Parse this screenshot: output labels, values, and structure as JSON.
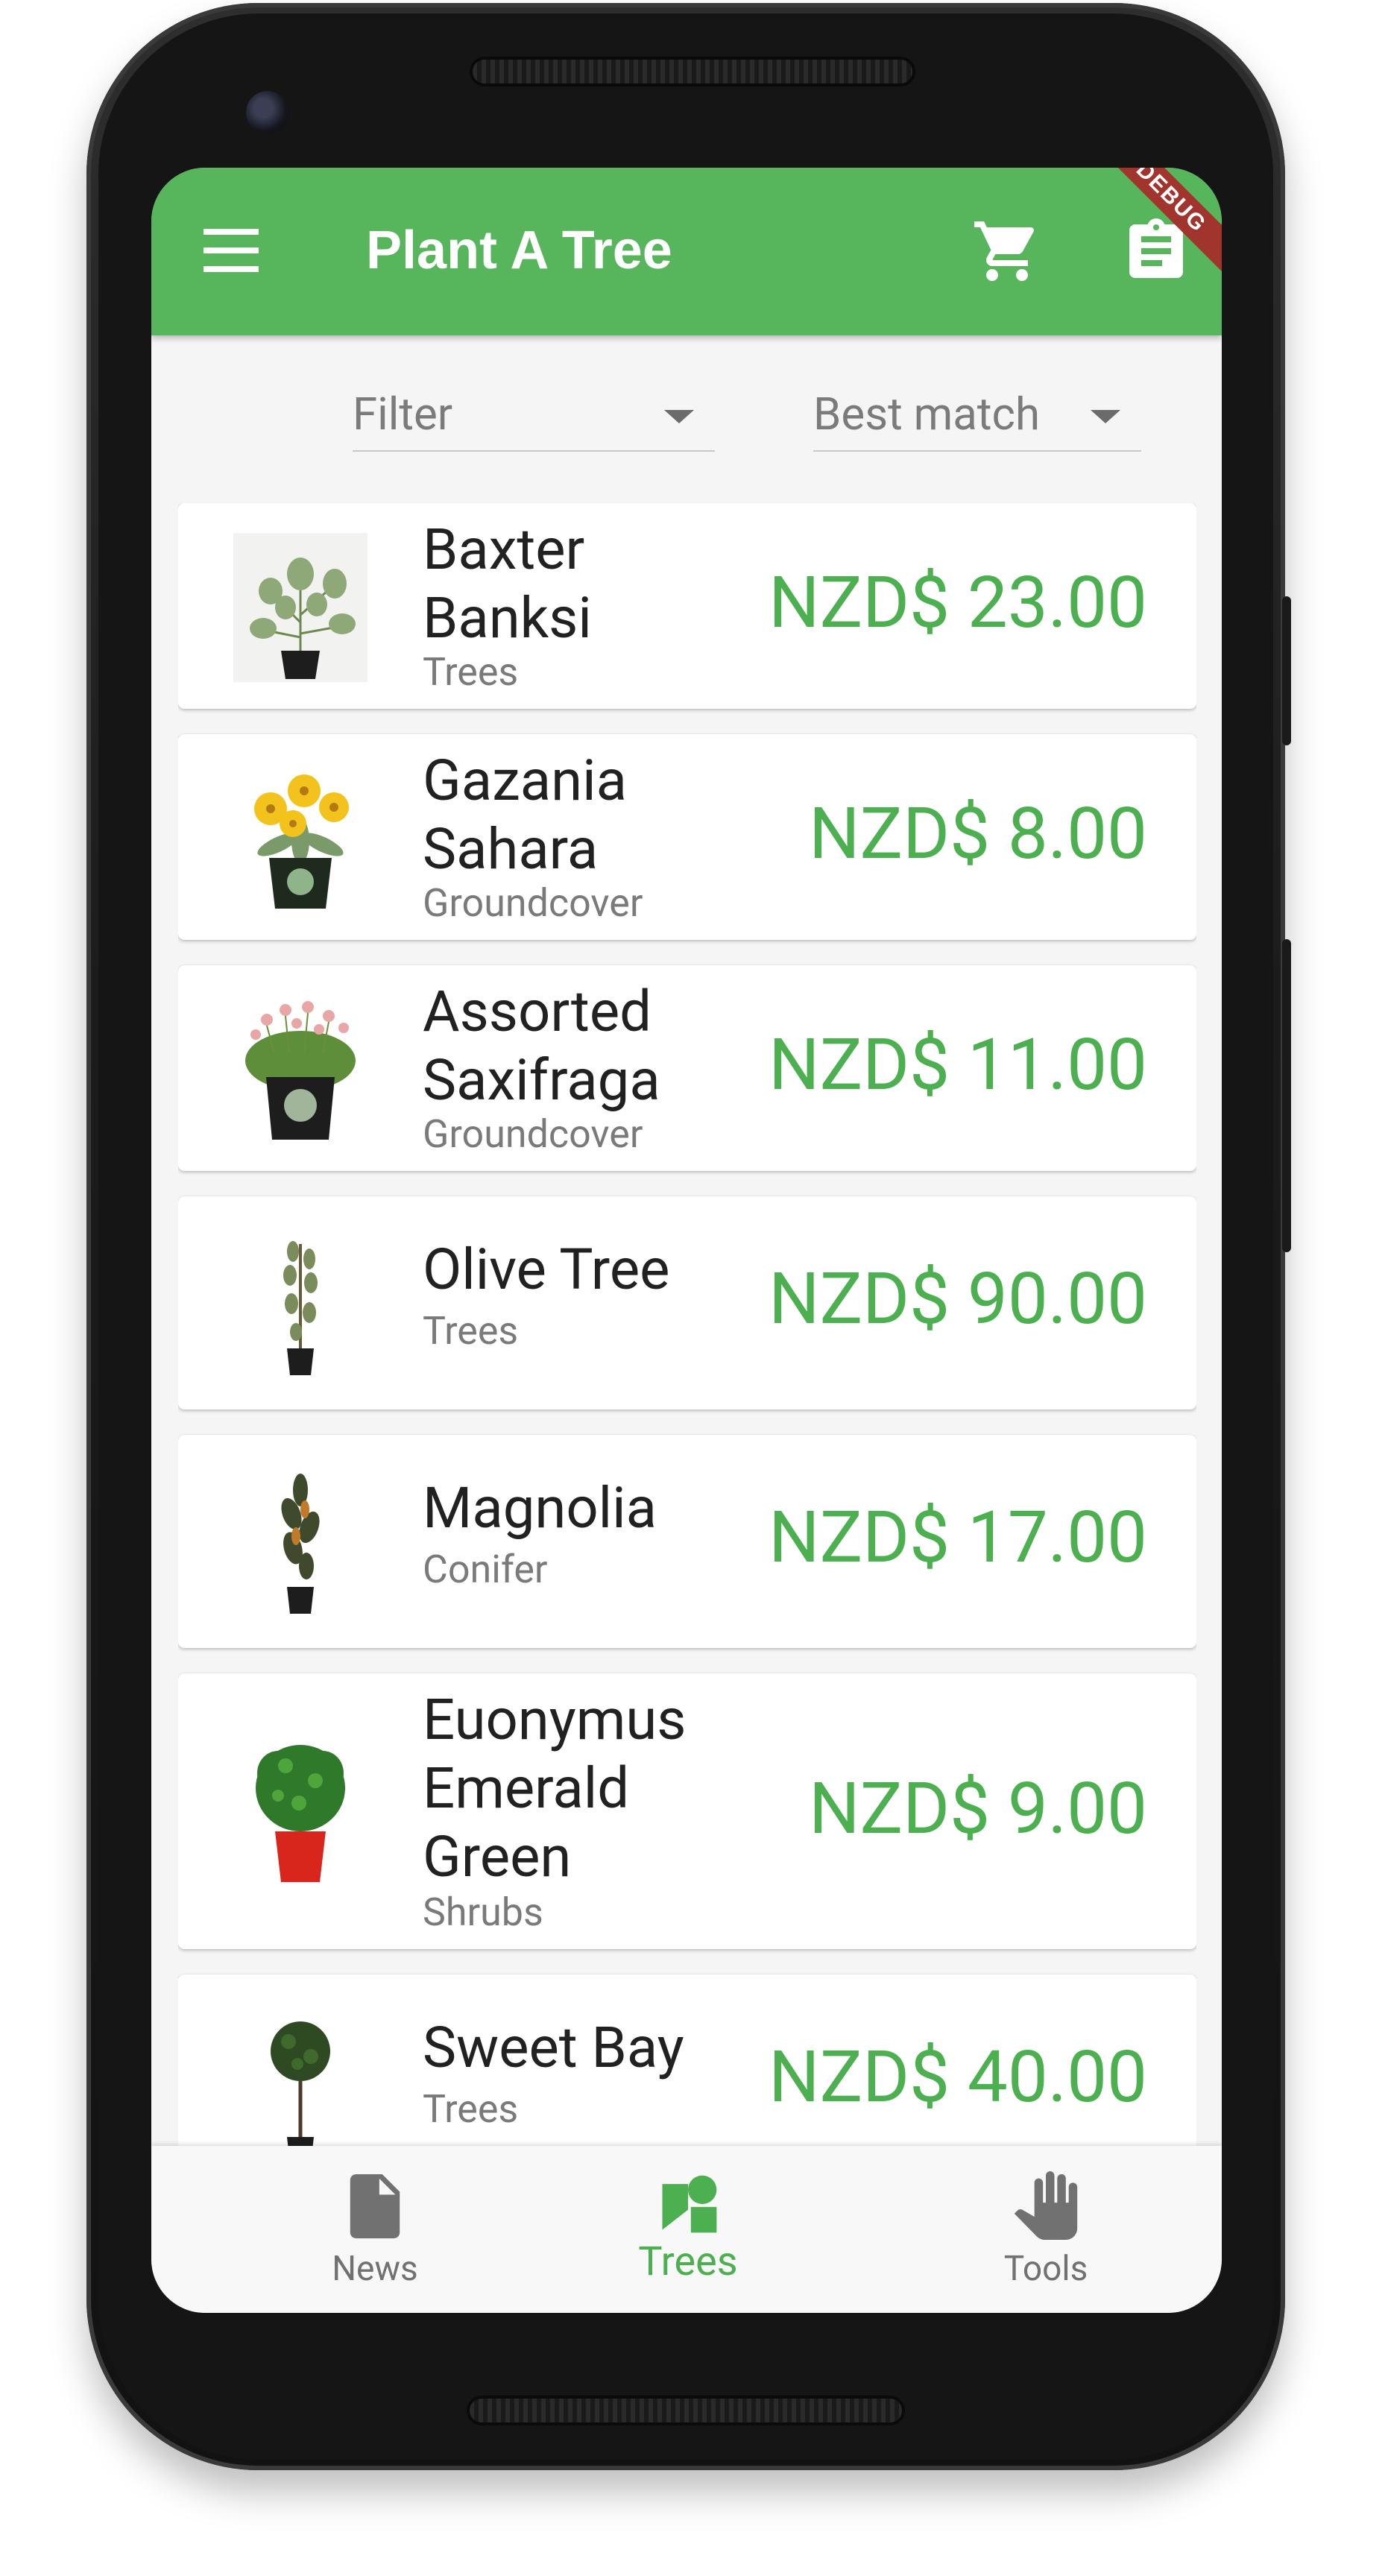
{
  "app": {
    "title": "Plant A Tree",
    "debug_banner": "DEBUG",
    "accent_color": "#57b55b",
    "price_color": "#4caf50"
  },
  "toolbar": {
    "menu_icon": "menu-icon",
    "cart_icon": "shopping-cart-icon",
    "orders_icon": "clipboard-icon"
  },
  "filters": {
    "filter_label": "Filter",
    "sort_label": "Best match"
  },
  "products": [
    {
      "name_line1": "Baxter",
      "name_line2": "Banksi",
      "category": "Trees",
      "price": "NZD$ 23.00"
    },
    {
      "name_line1": "Gazania",
      "name_line2": "Sahara",
      "category": "Groundcover",
      "price": "NZD$ 8.00"
    },
    {
      "name_line1": "Assorted",
      "name_line2": "Saxifraga",
      "category": "Groundcover",
      "price": "NZD$ 11.00"
    },
    {
      "name": "Olive Tree",
      "category": "Trees",
      "price": "NZD$ 90.00"
    },
    {
      "name": "Magnolia",
      "category": "Conifer",
      "price": "NZD$ 17.00"
    },
    {
      "name_line1": "Euonymus",
      "name_line2": "Emerald",
      "name_line3": "Green",
      "category": "Shrubs",
      "price": "NZD$ 9.00"
    },
    {
      "name": "Sweet Bay",
      "category": "Trees",
      "price": "NZD$ 40.00"
    }
  ],
  "bottom_nav": {
    "items": [
      {
        "label": "News",
        "icon": "document-icon",
        "selected": false
      },
      {
        "label": "Trees",
        "icon": "category-shapes-icon",
        "selected": true
      },
      {
        "label": "Tools",
        "icon": "hand-icon",
        "selected": false
      }
    ]
  }
}
